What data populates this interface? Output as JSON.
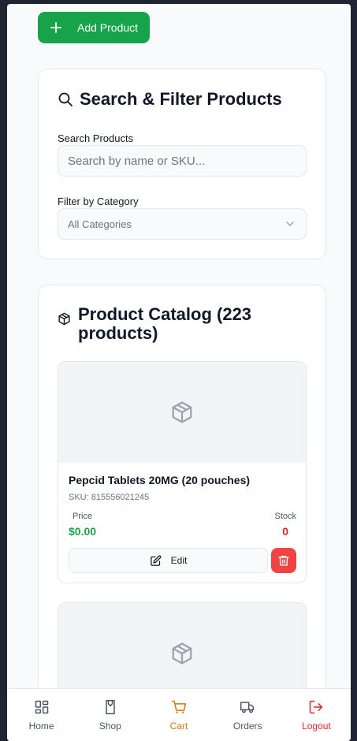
{
  "toolbar": {
    "add_product_label": "Add Product"
  },
  "search_card": {
    "title": "Search & Filter Products",
    "search_label": "Search Products",
    "search_placeholder": "Search by name or SKU...",
    "category_label": "Filter by Category",
    "category_selected": "All Categories"
  },
  "catalog": {
    "title": "Product Catalog (223 products)",
    "products": [
      {
        "name": "Pepcid Tablets 20MG (20 pouches)",
        "sku": "SKU: 815556021245",
        "price_label": "Price",
        "price": "$0.00",
        "stock_label": "Stock",
        "stock": "0",
        "edit_label": "Edit"
      }
    ]
  },
  "nav": {
    "items": [
      {
        "label": "Home",
        "icon": "grid-icon",
        "color": "#4b5563"
      },
      {
        "label": "Shop",
        "icon": "shop-icon",
        "color": "#4b5563"
      },
      {
        "label": "Cart",
        "icon": "cart-icon",
        "color": "#d97706"
      },
      {
        "label": "Orders",
        "icon": "truck-icon",
        "color": "#4b5563"
      },
      {
        "label": "Logout",
        "icon": "logout-icon",
        "color": "#dc2626"
      }
    ]
  },
  "colors": {
    "primary": "#16a34a",
    "danger": "#ef4444",
    "active_nav": "#d97706"
  }
}
